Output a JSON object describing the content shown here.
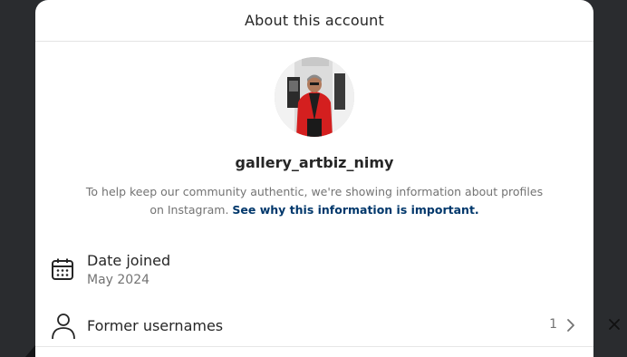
{
  "modal": {
    "title": "About this account"
  },
  "profile": {
    "username": "gallery_artbiz_nimy",
    "avatar": "profile-photo"
  },
  "info": {
    "text": "To help keep our community authentic, we're showing information about profiles on Instagram.",
    "link": "See why this information is important."
  },
  "date_joined": {
    "label": "Date joined",
    "value": "May 2024",
    "icon": "calendar-icon"
  },
  "former_usernames": {
    "label": "Former usernames",
    "count": "1",
    "icon": "person-icon"
  },
  "close": {
    "icon": "close-icon"
  },
  "colors": {
    "link": "#00376b",
    "text": "#262626",
    "secondary": "#737373",
    "backdrop": "#2a2c2f"
  }
}
